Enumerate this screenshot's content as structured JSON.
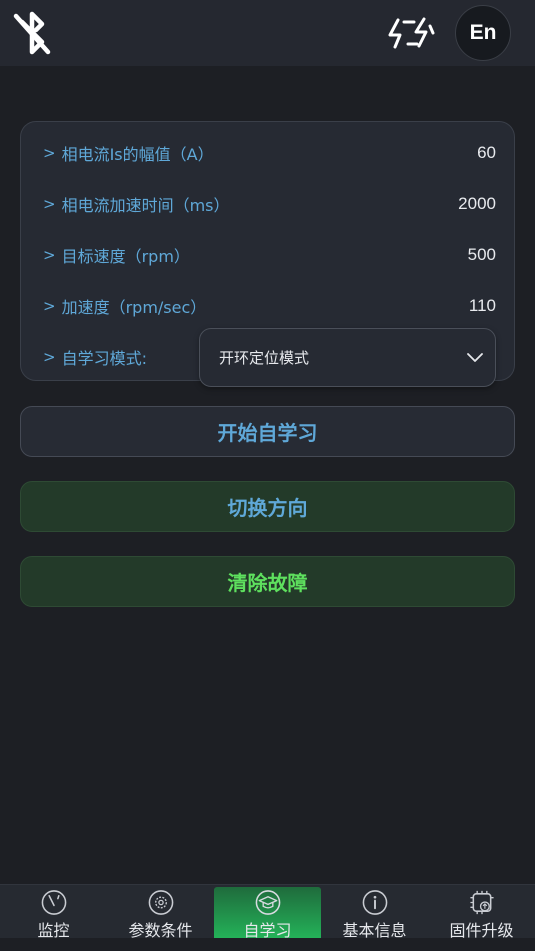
{
  "header": {
    "bluetooth_icon": "bluetooth-off-icon",
    "sync_icon": "sync-bolt-icon",
    "language_label": "En"
  },
  "params": [
    {
      "label": "相电流Is的幅值（A）",
      "value": "60"
    },
    {
      "label": "相电流加速时间（ms）",
      "value": "2000"
    },
    {
      "label": "目标速度（rpm）",
      "value": "500"
    },
    {
      "label": "加速度（rpm/sec）",
      "value": "110"
    }
  ],
  "mode": {
    "label": "自学习模式:",
    "selected": "开环定位模式"
  },
  "buttons": {
    "start": "开始自学习",
    "switch_direction": "切换方向",
    "clear_fault": "清除故障"
  },
  "colors": {
    "accent_blue": "#5fa8d8",
    "accent_green": "#5ee05e",
    "active_tab": "#24b65a"
  },
  "tabs": [
    {
      "label": "监控",
      "icon": "gauge-icon"
    },
    {
      "label": "参数条件",
      "icon": "settings-gear-icon"
    },
    {
      "label": "自学习",
      "icon": "graduation-cap-icon",
      "active": true
    },
    {
      "label": "基本信息",
      "icon": "info-icon"
    },
    {
      "label": "固件升级",
      "icon": "chip-upgrade-icon"
    }
  ]
}
